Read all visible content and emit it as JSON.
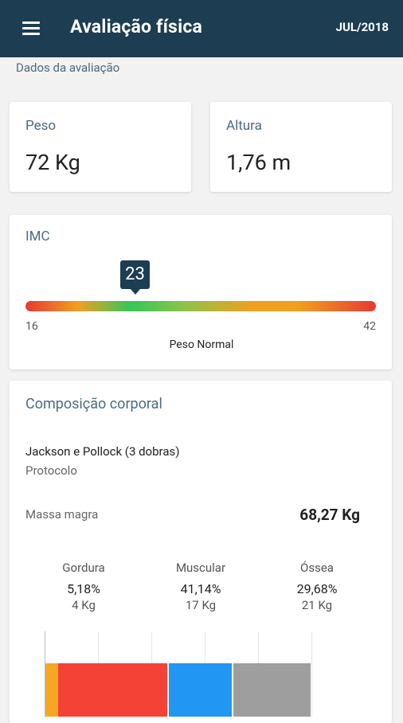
{
  "appbar": {
    "title": "Avaliação física",
    "date": "JUL/2018"
  },
  "section_label": "Dados da avaliação",
  "weight": {
    "label": "Peso",
    "value": "72 Kg"
  },
  "height": {
    "label": "Altura",
    "value": "1,76 m"
  },
  "imc": {
    "label": "IMC",
    "value": "23",
    "min": "16",
    "max": "42",
    "classification": "Peso Normal"
  },
  "composition": {
    "title": "Composição corporal",
    "protocol_name": "Jackson e Pollock (3 dobras)",
    "protocol_label": "Protocolo",
    "lean_mass_label": "Massa magra",
    "lean_mass_value": "68,27 Kg",
    "stats": [
      {
        "name": "Gordura",
        "percent": "5,18%",
        "kg": "4 Kg"
      },
      {
        "name": "Muscular",
        "percent": "41,14%",
        "kg": "17 Kg"
      },
      {
        "name": "Óssea",
        "percent": "29,68%",
        "kg": "21 Kg"
      }
    ],
    "bar_colors": {
      "fat": "#f5a623",
      "muscle": "#f44336",
      "bone": "#2196f3",
      "residual": "#9e9e9e"
    }
  }
}
